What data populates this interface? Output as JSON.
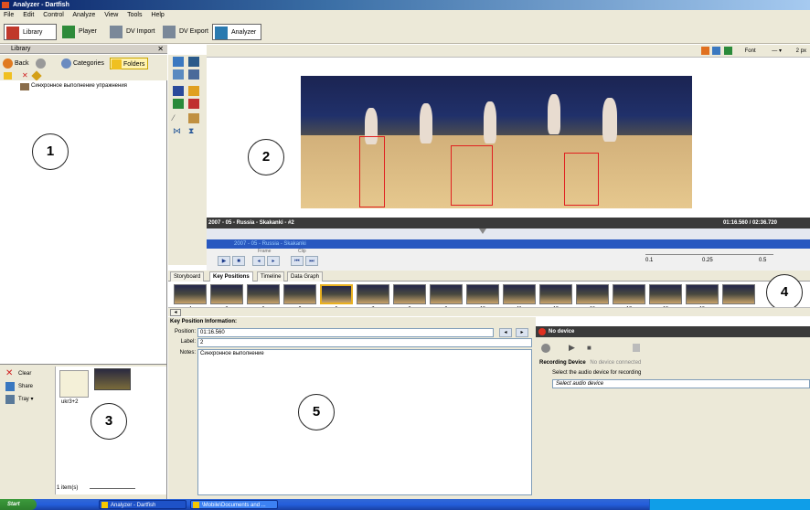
{
  "window": {
    "title": "Analyzer - Dartfish"
  },
  "menu": [
    "File",
    "Edit",
    "Control",
    "Analyze",
    "View",
    "Tools",
    "Help"
  ],
  "modes": [
    "Library",
    "Player",
    "DV Import",
    "DV Export",
    "Analyzer"
  ],
  "library": {
    "header": "Library",
    "close": "✕",
    "back": "Back",
    "categories": "Categories",
    "folders": "Folders",
    "tree_item": "Синхронное выполнение упражнения"
  },
  "callouts": [
    "1",
    "2",
    "3",
    "4",
    "5"
  ],
  "tray": {
    "clear": "Clear",
    "share": "Share",
    "tray_menu": "Tray ▾",
    "thumb_caption": "ukr3+2",
    "footer": "1 item(s)"
  },
  "drawing": {
    "font_label": "Font",
    "size_label": "2 px"
  },
  "video": {
    "clip_info": "2007 - 05 - Russia - Skakanki - #2",
    "timecode": "01:16.560 / 02:36.720",
    "clip_bar": "2007 - 05 - Russia - Skakanki"
  },
  "transport": {
    "frame_label": "Frame",
    "clip_label": "Clip",
    "speed_ticks": [
      "0.1",
      "0.25",
      "0.5"
    ]
  },
  "tabs": [
    "Storyboard",
    "Key Positions",
    "Timeline",
    "Data Graph"
  ],
  "active_tab": "Key Positions",
  "key_positions": [
    "4",
    "3",
    "6",
    "2",
    "5",
    "7",
    "8",
    "9",
    "10",
    "11",
    "12",
    "16",
    "17",
    "18",
    "19"
  ],
  "kp_info": {
    "title": "Key Position Information:",
    "position_label": "Position:",
    "position_value": "01:16.560",
    "label_label": "Label:",
    "label_value": "2",
    "notes_label": "Notes:",
    "notes_value": "Синхронное выполнение"
  },
  "audio": {
    "header": "No device",
    "recording_device": "Recording Device",
    "no_device_connected": "No device connected",
    "select_prompt": "Select the audio device for recording",
    "select_placeholder": "Select audio device"
  },
  "taskbar": {
    "start": "Start",
    "items": [
      "Analyzer - Dartfish",
      "\\Mobile\\Documents and ..."
    ]
  }
}
